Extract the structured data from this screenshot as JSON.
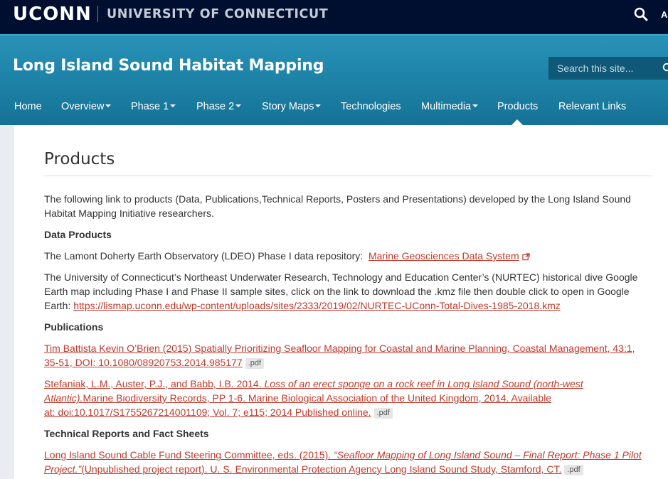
{
  "topbar": {
    "logo": "UCONN",
    "university": "UNIVERSITY OF CONNECTICUT",
    "search_icon": "search-icon",
    "a_label": "A"
  },
  "banner": {
    "site_title": "Long Island Sound Habitat Mapping",
    "search_placeholder": "Search this site...",
    "search_icon": "search-icon"
  },
  "nav": [
    {
      "label": "Home",
      "dropdown": false
    },
    {
      "label": "Overview",
      "dropdown": true
    },
    {
      "label": "Phase 1",
      "dropdown": true
    },
    {
      "label": "Phase 2",
      "dropdown": true
    },
    {
      "label": "Story Maps",
      "dropdown": true
    },
    {
      "label": "Technologies",
      "dropdown": false
    },
    {
      "label": "Multimedia",
      "dropdown": true
    },
    {
      "label": "Products",
      "dropdown": false,
      "active": true
    },
    {
      "label": "Relevant Links",
      "dropdown": false
    }
  ],
  "page": {
    "title": "Products",
    "intro_line1": "The following link to products (Data, Publications,Technical Reports, Posters and Presentations) developed by the Long Island Sound",
    "intro_line2": "Habitat Mapping Initiative researchers.",
    "data_products_heading": "Data Products",
    "ldeo_text": "The Lamont Doherty Earth Observatory (LDEO) Phase I data repository:",
    "ldeo_link": "Marine Geosciences Data System",
    "nurtec_line1": "The University of Connecticut’s Northeast Underwater Research, Technology and Education Center’s (NURTEC) historical dive Google",
    "nurtec_line2": "Earth map including Phase I and Phase II sample sites, click on the link to download the .kmz file then double click to open in Google",
    "nurtec_line3_prefix": "Earth:",
    "nurtec_link": "https://lismap.uconn.edu/wp-content/uploads/sites/2333/2019/02/NURTEC-UConn-Total-Dives-1985-2018.kmz",
    "publications_heading": "Publications",
    "pub1_line1": "Tim Battista Kevin O’Brien (2015) Spatially Prioritizing Seafloor Mapping for Coastal and Marine Planning, Coastal Management, 43:1,",
    "pub1_line2": "35-51, DOI: 10.1080/08920753.2014.985177",
    "pub2_line1_normal": "Stefaniak, L.M., Auster, P.J., and Babb, I.B. 2014.",
    "pub2_line1_italic": "Loss of an erect sponge on a rock reef in Long Island Sound (north-west",
    "pub2_line2_italic": "Atlantic).",
    "pub2_line2_normal": "Marine Biodiversity Records, PP 1-6. Marine Biological Association of the United Kingdom, 2014. Available",
    "pub2_line3": "at: doi:10.1017/S1755267214001109; Vol. 7; e115; 2014 Published online.",
    "tech_heading": "Technical Reports and Fact Sheets",
    "tech1_line1_normal": "Long Island Sound Cable Fund Steering Committee, eds. (2015).",
    "tech1_line1_italic": "“Seafloor Mapping of Long Island Sound – Final Report: Phase 1 Pilot",
    "tech1_line2_italic": "Project.”",
    "tech1_line2_normal": "(Unpublished project report). U. S. Environmental Protection Agency Long Island Sound Study, Stamford, CT.",
    "pdf_label": ".pdf"
  },
  "colors": {
    "topbar": "#000e2f",
    "banner": "#1f84a9",
    "link": "#c0392b"
  }
}
